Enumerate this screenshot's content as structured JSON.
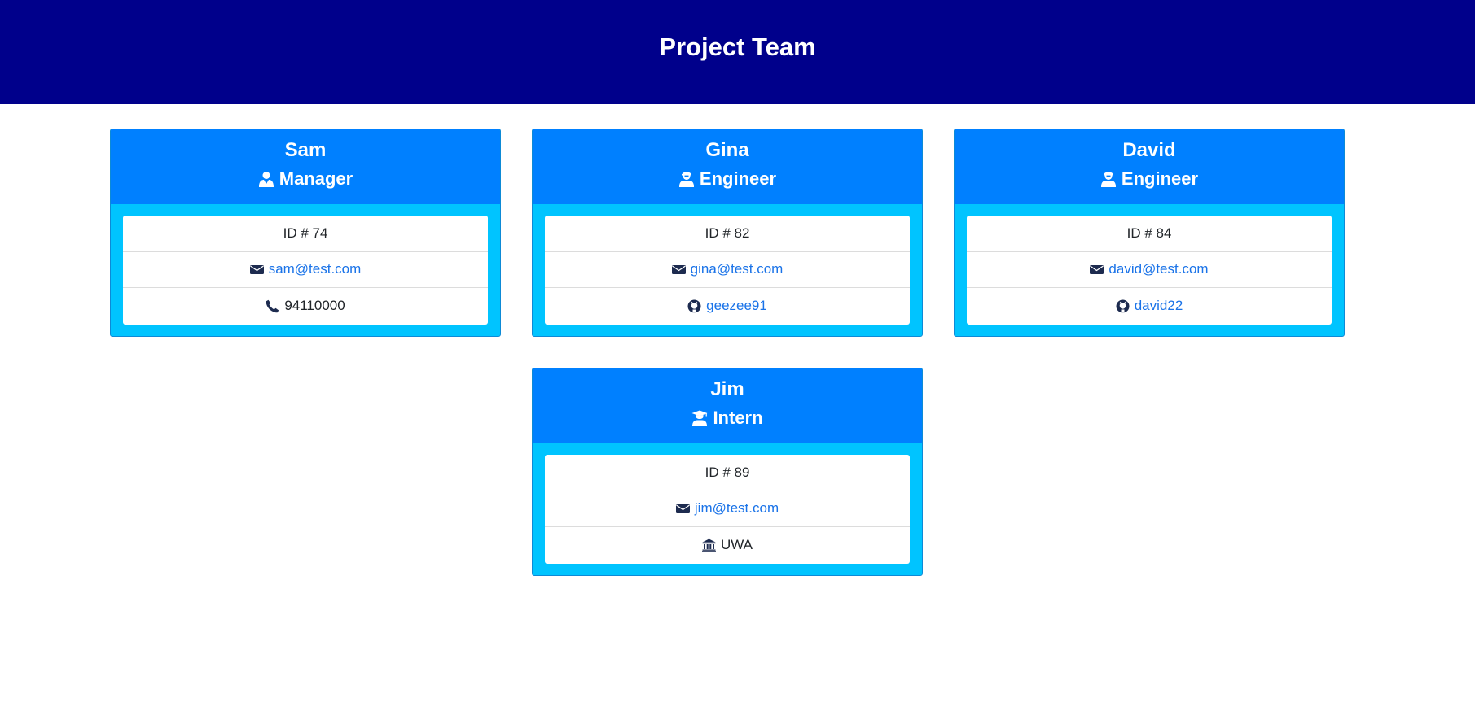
{
  "header": {
    "title": "Project Team"
  },
  "cards": [
    {
      "name": "Sam",
      "role": "Manager",
      "role_icon": "user-tie-icon",
      "id_text": "ID # 74",
      "email": "sam@test.com",
      "extra_text": "94110000",
      "extra_icon": "phone-icon"
    },
    {
      "name": "Gina",
      "role": "Engineer",
      "role_icon": "engineer-icon",
      "id_text": "ID # 82",
      "email": "gina@test.com",
      "extra_text": "geezee91",
      "extra_icon": "github-icon"
    },
    {
      "name": "David",
      "role": "Engineer",
      "role_icon": "engineer-icon",
      "id_text": "ID # 84",
      "email": "david@test.com",
      "extra_text": "david22",
      "extra_icon": "github-icon"
    },
    {
      "name": "Jim",
      "role": "Intern",
      "role_icon": "graduate-icon",
      "id_text": "ID # 89",
      "email": "jim@test.com",
      "extra_text": "UWA",
      "extra_icon": "university-icon"
    }
  ],
  "colors": {
    "header_bg": "#00008b",
    "card_head_bg": "#0080ff",
    "card_body_bg": "#00c4ff",
    "link": "#1a73e8"
  }
}
